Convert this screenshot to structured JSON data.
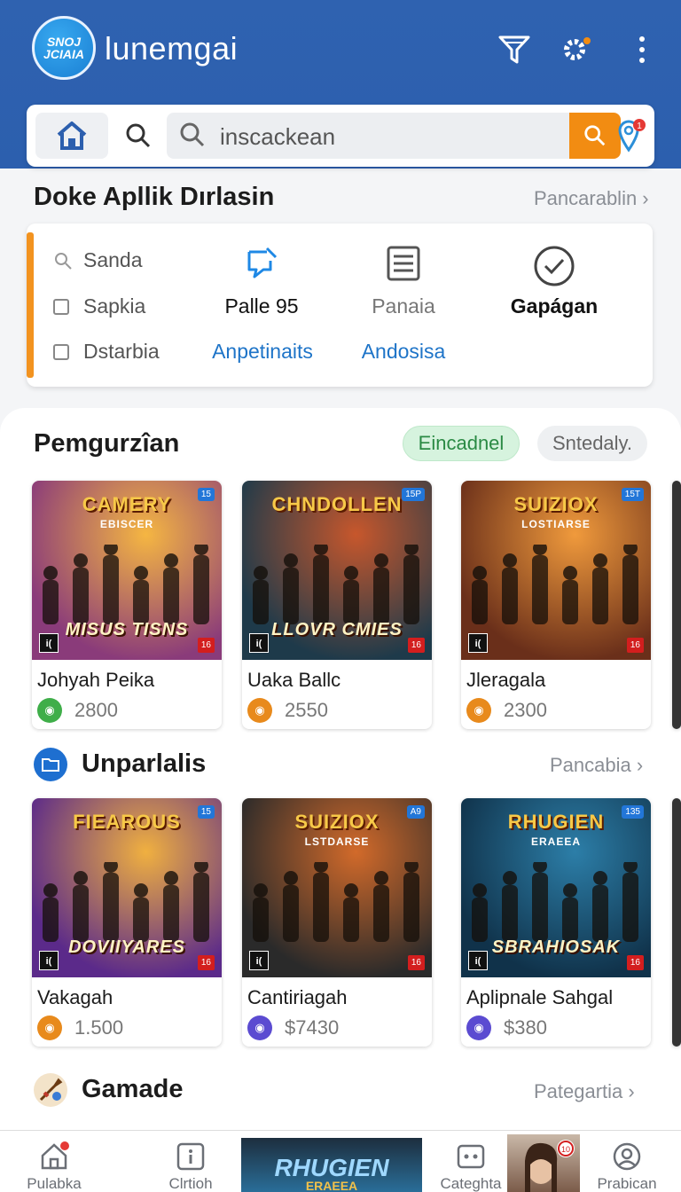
{
  "app": {
    "title": "lunemgai",
    "logo_text": "SNOJ JCIAIA",
    "colors": {
      "primary": "#2c5fae",
      "accent": "#f28c12",
      "green_chip": "#d6f3de"
    }
  },
  "top_icons": [
    "filter-icon",
    "gear-icon",
    "more-vert-icon"
  ],
  "search": {
    "value": "inscackean",
    "home_icon": "home-icon",
    "location_badge": "1"
  },
  "filters_section": {
    "title": "Doke Apllik Dırlasin",
    "link": "Pancarablin",
    "items_left": [
      "Sanda",
      "Sapkia",
      "Dstarbia"
    ],
    "col2": {
      "value": "Palle 95",
      "link": "Anpetinaits"
    },
    "col3": {
      "value": "Panaia",
      "link": "Andosisa"
    },
    "col4": {
      "value": "Gapágan"
    }
  },
  "section1": {
    "title": "Pemgurzîan",
    "chips": [
      "Eincadnel",
      "Sntedaly."
    ],
    "games": [
      {
        "name": "Johyah Peika",
        "price": "2800",
        "coin_color": "#3fae49",
        "art_top": "CAMERY",
        "art_sub": "EBISCER",
        "art_bottom": "MISUS TISNS",
        "badge": "15",
        "hue": [
          "#8a3b7a",
          "#f5b642"
        ]
      },
      {
        "name": "Uaka Ballc",
        "price": "2550",
        "coin_color": "#e88a1c",
        "art_top": "CHNDOLLEN",
        "art_sub": "",
        "art_bottom": "LLOVR CMIES",
        "badge": "15P",
        "hue": [
          "#1e3a4a",
          "#c7572c"
        ]
      },
      {
        "name": "Jleragala",
        "price": "2300",
        "coin_color": "#e88a1c",
        "art_top": "SUIZIOX",
        "art_sub": "LOSTIARSE",
        "art_bottom": "",
        "badge": "15T",
        "hue": [
          "#6a2f1a",
          "#f09a3c"
        ]
      }
    ]
  },
  "section2": {
    "title": "Unparlalis",
    "link": "Pancabia",
    "games": [
      {
        "name": "Vakagah",
        "price": "1.500",
        "coin_color": "#e88a1c",
        "art_top": "FIEAROUS",
        "art_sub": "",
        "art_bottom": "DOVIIYARES",
        "badge": "15",
        "hue": [
          "#5b2a8a",
          "#f0b040"
        ]
      },
      {
        "name": "Cantiriagah",
        "price": "$7430",
        "coin_color": "#5b4bd1",
        "art_top": "SUIZIOX",
        "art_sub": "LSTDARSE",
        "art_bottom": "",
        "badge": "A9",
        "hue": [
          "#2a2a2a",
          "#d26a2a"
        ]
      },
      {
        "name": "Aplipnale Sahgal",
        "price": "$380",
        "coin_color": "#5b4bd1",
        "art_top": "RHUGIEN",
        "art_sub": "ERAEEA",
        "art_bottom": "SBRAHIOSAK",
        "badge": "135",
        "hue": [
          "#10324a",
          "#2c7ea8"
        ]
      }
    ]
  },
  "section3": {
    "title": "Gamade",
    "link": "Pategartia"
  },
  "bottom_nav": [
    {
      "label": "Pulabka",
      "icon": "home-icon"
    },
    {
      "label": "Clrtioh",
      "icon": "info-square-icon"
    },
    {
      "label": "Categhta",
      "icon": "grid-dots-icon"
    },
    {
      "label": "Prabican",
      "icon": "profile-icon"
    }
  ],
  "nav_banner": {
    "title": "RHUGIEN",
    "sub": "ERAEEA"
  },
  "nav_avatar_badge": "10"
}
